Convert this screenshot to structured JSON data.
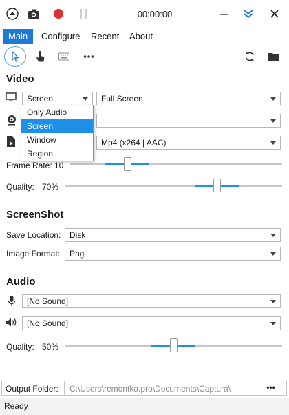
{
  "titlebar": {
    "time": "00:00:00",
    "icons": [
      "collapse-up-icon",
      "camera-icon",
      "record-icon",
      "pause-icon",
      "minimize-icon",
      "double-chevron-down-icon",
      "close-icon"
    ]
  },
  "menu": {
    "items": [
      {
        "label": "Main"
      },
      {
        "label": "Configure"
      },
      {
        "label": "Recent"
      },
      {
        "label": "About"
      }
    ]
  },
  "toolbar": {
    "icons": [
      "cursor-icon",
      "hand-pointer-icon",
      "keyboard-icon",
      "more-dots-icon",
      "refresh-icon",
      "folder-icon"
    ]
  },
  "video": {
    "title": "Video",
    "screen_value": "Screen",
    "fullscreen_value": "Full Screen",
    "format_value": "Mp4 (x264 | AAC)",
    "framerate_label": "Frame Rate:",
    "framerate_value": "10",
    "framerate_level": 0.27,
    "quality_label": "Quality:",
    "quality_value": "70%",
    "quality_level": 0.7,
    "dropdown_options": [
      "Only Audio",
      "Screen",
      "Window",
      "Region"
    ],
    "dropdown_selected": "Screen"
  },
  "screenshot": {
    "title": "ScreenShot",
    "save_location_label": "Save Location:",
    "save_location_value": "Disk",
    "image_format_label": "Image Format:",
    "image_format_value": "Png"
  },
  "audio": {
    "title": "Audio",
    "mic_value": "[No Sound]",
    "speaker_value": "[No Sound]",
    "quality_label": "Quality:",
    "quality_value": "50%",
    "quality_level": 0.5
  },
  "output": {
    "label": "Output Folder:",
    "path": "C:\\Users\\remontka.pro\\Documents\\Captura\\",
    "more_label": "•••"
  },
  "status": {
    "text": "Ready"
  },
  "colors": {
    "accent": "#1e7ad6",
    "record": "#d9322f",
    "slider_fill": "#1e90e8"
  }
}
